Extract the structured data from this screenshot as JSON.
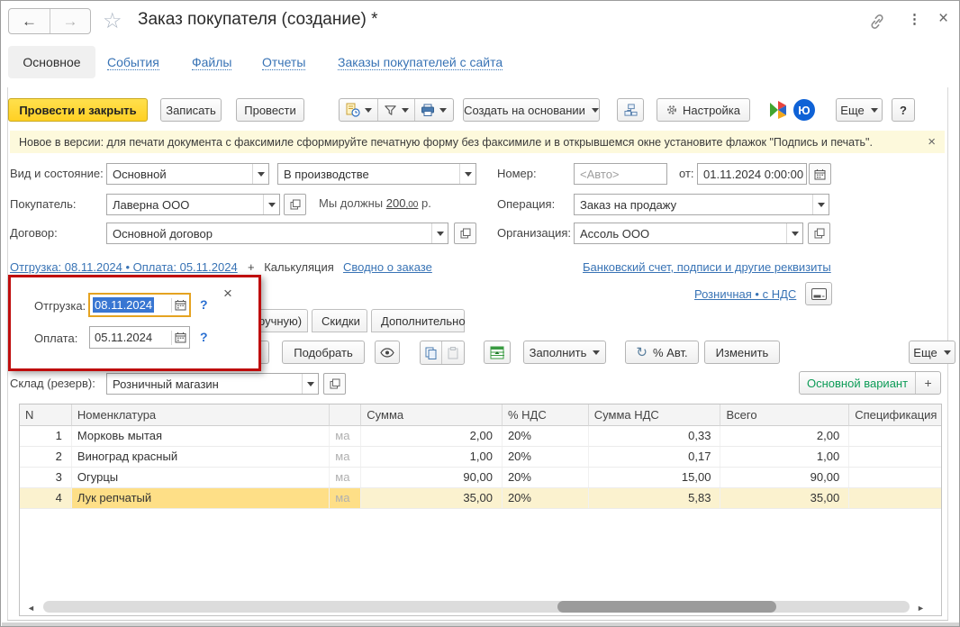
{
  "colors": {
    "accent_yellow": "#ffd024",
    "link_blue": "#3873b5",
    "popup_annotation_red": "#bf0d0d",
    "row_highlight": "#fbf2cf",
    "selected_cell": "#fedf87",
    "selection_blue": "#3976d2",
    "focus_orange": "#e5a321",
    "variant_green": "#0d9b57"
  },
  "icons": {
    "back": "←",
    "forward": "→",
    "favorite": "☆",
    "menu": "⋮",
    "close": "×",
    "banner_close": "×",
    "popup_close": "×",
    "help": "?",
    "refresh": "↻",
    "scroll_left": "◄",
    "scroll_right": "►",
    "yukassa": "Ю",
    "question": "?"
  },
  "header": {
    "title": "Заказ покупателя (создание) *"
  },
  "nav": {
    "active": "Основное",
    "links": [
      "События",
      "Файлы",
      "Отчеты",
      "Заказы покупателей с сайта"
    ]
  },
  "toolbar": {
    "post_and_close": "Провести и закрыть",
    "write": "Записать",
    "post": "Провести",
    "create_on_basis": "Создать на основании",
    "settings": "Настройка",
    "more": "Еще",
    "help": "?"
  },
  "banner": {
    "text": "Новое в версии: для печати документа с факсимиле сформируйте печатную форму без факсимиле и в открывшемся окне установите флажок \"Подпись и печать\"."
  },
  "fields": {
    "kind_label": "Вид и состояние:",
    "kind_value": "Основной",
    "state_value": "В производстве",
    "number_label": "Номер:",
    "number_placeholder": "<Авто>",
    "date_label": "от:",
    "date_value": "01.11.2024  0:00:00",
    "customer_label": "Покупатель:",
    "customer_value": "Лаверна ООО",
    "debt_prefix": "Мы должны",
    "debt_amount": "200",
    "debt_cents": ",00",
    "debt_suffix": "р.",
    "operation_label": "Операция:",
    "operation_value": "Заказ на продажу",
    "contract_label": "Договор:",
    "contract_value": "Основной договор",
    "org_label": "Организация:",
    "org_value": "Ассоль ООО"
  },
  "links_row": {
    "shipping_payment": "Отгрузка: 08.11.2024 • Оплата: 05.11.2024",
    "calc_prefix": "+",
    "calculation": "Калькуляция",
    "order_summary": "Сводно о заказе",
    "bank_account": "Банковский счет, подписи и другие реквизиты",
    "price_type": "Розничная • с НДС"
  },
  "popup": {
    "shipping_label": "Отгрузка:",
    "shipping_value": "08.11.2024",
    "payment_label": "Оплата:",
    "payment_value": "05.11.2024"
  },
  "content_tabs": {
    "partial": "ручную)",
    "discounts": "Скидки",
    "additional": "Дополнительно"
  },
  "table_toolbar": {
    "pick": "Подобрать",
    "fill": "Заполнить",
    "auto_percent": "% Авт.",
    "change": "Изменить",
    "more": "Еще"
  },
  "warehouse": {
    "label": "Склад (резерв):",
    "value": "Розничный магазин"
  },
  "variant": {
    "label": "Основной вариант",
    "add": "+"
  },
  "table": {
    "columns": [
      "N",
      "Номенклатура",
      "",
      "Сумма",
      "% НДС",
      "Сумма НДС",
      "Всего",
      "Спецификация"
    ],
    "rows": [
      {
        "n": "1",
        "name": "Морковь мытая",
        "partial": "ма",
        "sum": "2,00",
        "vat": "20%",
        "vat_sum": "0,33",
        "total": "2,00",
        "spec": ""
      },
      {
        "n": "2",
        "name": "Виноград красный",
        "partial": "ма",
        "sum": "1,00",
        "vat": "20%",
        "vat_sum": "0,17",
        "total": "1,00",
        "spec": ""
      },
      {
        "n": "3",
        "name": "Огурцы",
        "partial": "ма",
        "sum": "90,00",
        "vat": "20%",
        "vat_sum": "15,00",
        "total": "90,00",
        "spec": ""
      },
      {
        "n": "4",
        "name": "Лук репчатый",
        "partial": "ма",
        "sum": "35,00",
        "vat": "20%",
        "vat_sum": "5,83",
        "total": "35,00",
        "spec": ""
      }
    ]
  }
}
